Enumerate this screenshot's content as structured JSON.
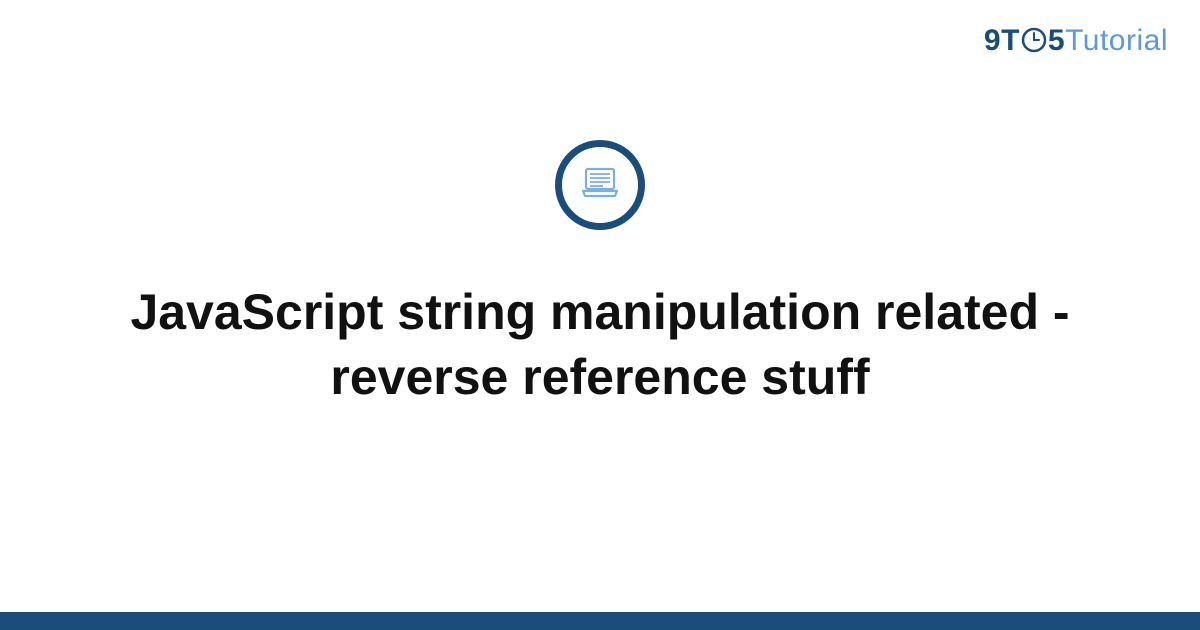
{
  "brand": {
    "prefix_nine": "9",
    "prefix_t": "T",
    "prefix_five": "5",
    "suffix": "Tutorial"
  },
  "main": {
    "title": "JavaScript string manipulation related - reverse reference stuff"
  },
  "colors": {
    "brand_dark": "#1a4d7a",
    "brand_light": "#5a9bd4"
  }
}
